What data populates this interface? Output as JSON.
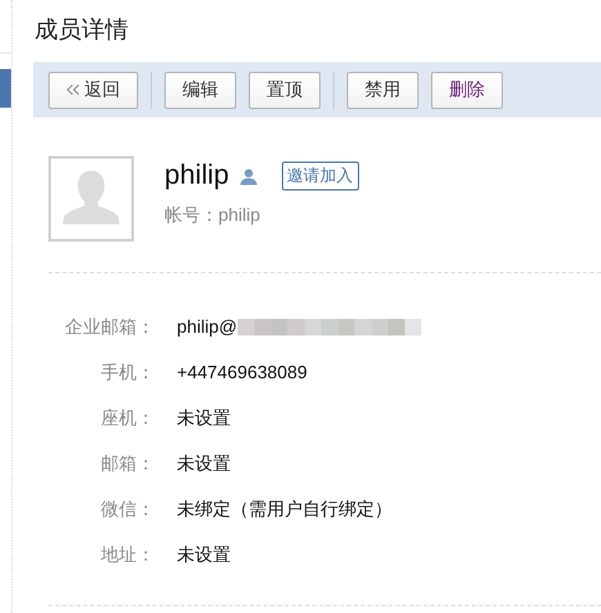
{
  "title": "成员详情",
  "toolbar": [
    {
      "label": "返回",
      "kind": "back"
    },
    {
      "kind": "divider"
    },
    {
      "label": "编辑",
      "kind": "button"
    },
    {
      "label": "置顶",
      "kind": "button"
    },
    {
      "kind": "divider"
    },
    {
      "label": "禁用",
      "kind": "button"
    },
    {
      "label": "删除",
      "kind": "danger"
    }
  ],
  "profile": {
    "name": "philip",
    "invite_button": "邀请加入",
    "account_label": "帐号：",
    "account": "philip"
  },
  "fields": [
    {
      "label": "企业邮箱：",
      "value": "philip@",
      "kind": "redacted"
    },
    {
      "label": "手机：",
      "value": "+447469638089",
      "kind": "text"
    },
    {
      "label": "座机：",
      "value": "未设置",
      "kind": "text"
    },
    {
      "label": "邮箱：",
      "value": "未设置",
      "kind": "text"
    },
    {
      "label": "微信：",
      "value": "未绑定（需用户自行绑定）",
      "kind": "text"
    },
    {
      "label": "地址：",
      "value": "未设置",
      "kind": "text"
    }
  ]
}
